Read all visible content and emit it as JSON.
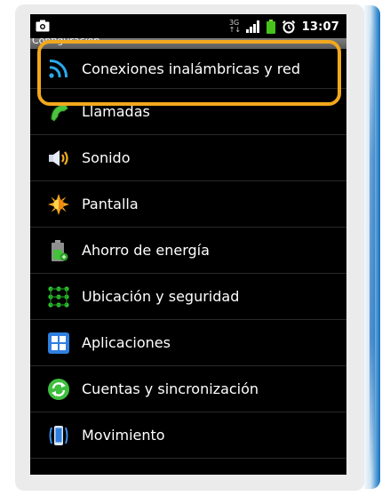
{
  "status_bar": {
    "network_type_top": "3G",
    "network_type_bottom": "↑↓",
    "time": "13:07",
    "icons": [
      "screenshot-icon",
      "network-type-icon",
      "signal-bars-icon",
      "battery-icon",
      "alarm-icon"
    ]
  },
  "header": {
    "title": "Configuración"
  },
  "settings_items": [
    {
      "label": "Conexiones inalámbricas y red",
      "icon": "wifi-icon"
    },
    {
      "label": "Llamadas",
      "icon": "phone-handset-icon"
    },
    {
      "label": "Sonido",
      "icon": "speaker-icon"
    },
    {
      "label": "Pantalla",
      "icon": "brightness-icon"
    },
    {
      "label": "Ahorro de energía",
      "icon": "battery-saver-icon"
    },
    {
      "label": "Ubicación y seguridad",
      "icon": "location-grid-icon"
    },
    {
      "label": "Aplicaciones",
      "icon": "apps-grid-icon"
    },
    {
      "label": "Cuentas y sincronización",
      "icon": "sync-icon"
    },
    {
      "label": "Movimiento",
      "icon": "motion-phone-icon"
    }
  ],
  "colors": {
    "highlight": "#f2a81d",
    "screen_background": "#000000",
    "card_background": "#ebebeb",
    "accent_blue": "#1c6fb8"
  }
}
